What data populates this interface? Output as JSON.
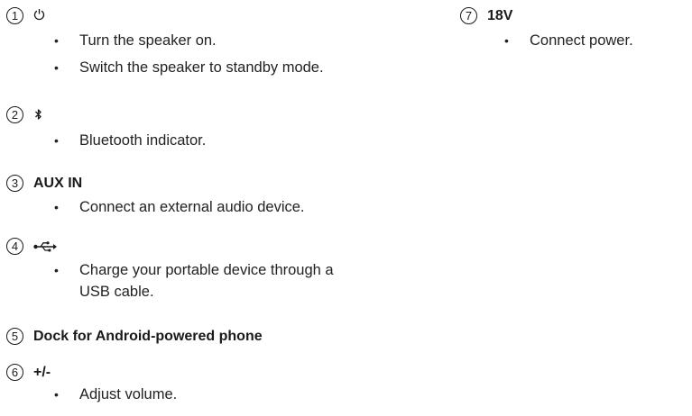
{
  "items": [
    {
      "number": "1",
      "heading": "",
      "icon": "power-icon",
      "bullets": [
        "Turn the speaker on.",
        "Switch the speaker to standby mode."
      ]
    },
    {
      "number": "2",
      "heading": "",
      "icon": "bluetooth-icon",
      "bullets": [
        "Bluetooth indicator."
      ]
    },
    {
      "number": "3",
      "heading": "AUX IN",
      "icon": "",
      "bullets": [
        "Connect an external audio device."
      ]
    },
    {
      "number": "4",
      "heading": "",
      "icon": "usb-icon",
      "bullets": [
        "Charge your portable device through a USB cable."
      ]
    },
    {
      "number": "5",
      "heading": "Dock for Android-powered phone",
      "icon": "",
      "bullets": []
    },
    {
      "number": "6",
      "heading": "+/-",
      "icon": "",
      "bullets": [
        "Adjust volume."
      ]
    },
    {
      "number": "7",
      "heading": "18V",
      "icon": "",
      "bullets": [
        "Connect power."
      ]
    }
  ],
  "bullet_char": "•"
}
